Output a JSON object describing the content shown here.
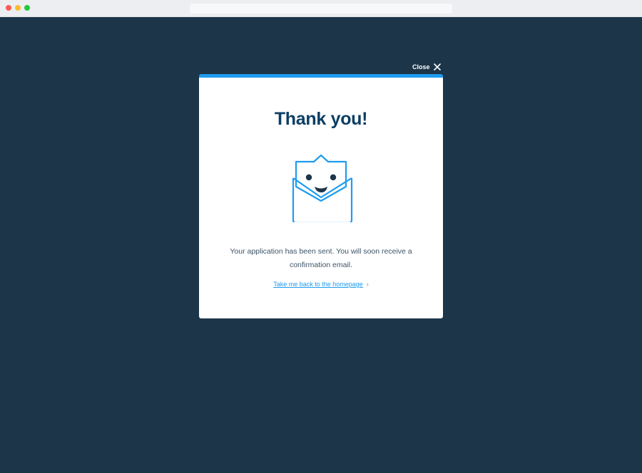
{
  "window": {
    "background_color": "#1c3549",
    "traffic_lights": [
      "red-dot",
      "yellow-dot",
      "green-dot"
    ]
  },
  "modal": {
    "close_label": "Close",
    "title": "Thank you!",
    "message": "Your application has been sent. You will soon receive a confirmation email.",
    "link_text": "Take me back to the homepage",
    "link_chevron": "›",
    "accent_color": "#1e9cf0",
    "title_color": "#0d3e63",
    "illustration": "smiling-envelope-icon"
  }
}
